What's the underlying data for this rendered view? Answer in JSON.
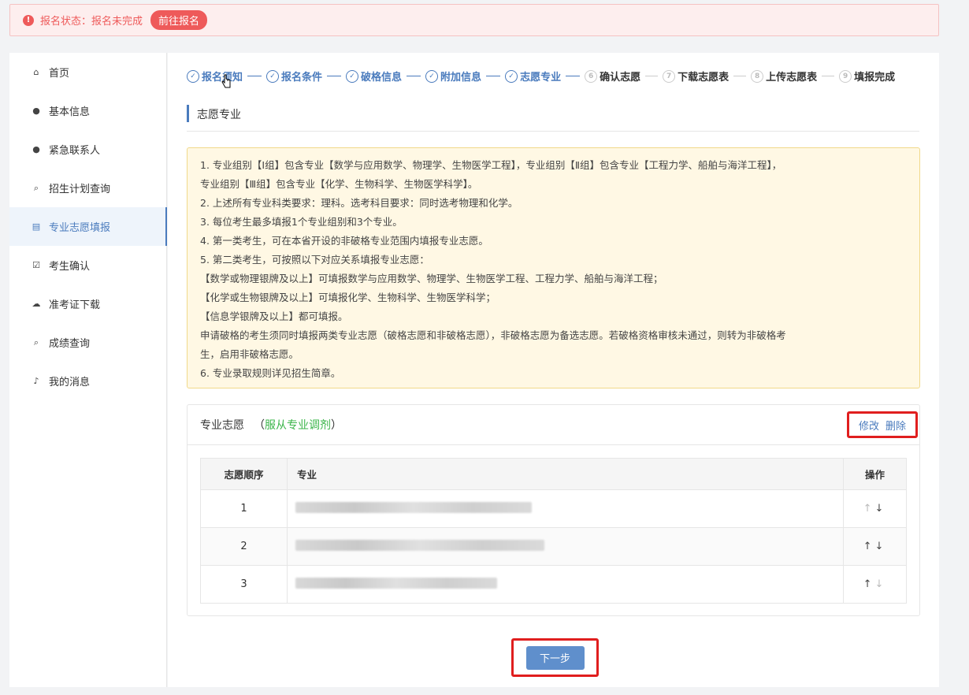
{
  "alert": {
    "status_text": "报名状态：报名未完成",
    "action_label": "前往报名",
    "icon": "info-icon"
  },
  "sidebar": {
    "items": [
      {
        "label": "首页",
        "icon": "home-icon",
        "glyph": "⌂",
        "active": false
      },
      {
        "label": "基本信息",
        "icon": "user-icon",
        "glyph": "●",
        "active": false
      },
      {
        "label": "紧急联系人",
        "icon": "user-icon",
        "glyph": "●",
        "active": false
      },
      {
        "label": "招生计划查询",
        "icon": "search-icon",
        "glyph": "⌕",
        "active": false
      },
      {
        "label": "专业志愿填报",
        "icon": "document-icon",
        "glyph": "▤",
        "active": true
      },
      {
        "label": "考生确认",
        "icon": "checkbox-icon",
        "glyph": "☑",
        "active": false
      },
      {
        "label": "准考证下载",
        "icon": "cloud-download-icon",
        "glyph": "☁",
        "active": false
      },
      {
        "label": "成绩查询",
        "icon": "search-icon",
        "glyph": "⌕",
        "active": false
      },
      {
        "label": "我的消息",
        "icon": "bell-icon",
        "glyph": "♪",
        "active": false
      }
    ]
  },
  "steps": [
    {
      "label": "报名须知",
      "done": true,
      "mark": "✓"
    },
    {
      "label": "报名条件",
      "done": true,
      "mark": "✓"
    },
    {
      "label": "破格信息",
      "done": true,
      "mark": "✓"
    },
    {
      "label": "附加信息",
      "done": true,
      "mark": "✓"
    },
    {
      "label": "志愿专业",
      "done": true,
      "mark": "✓"
    },
    {
      "label": "确认志愿",
      "done": false,
      "mark": "6"
    },
    {
      "label": "下载志愿表",
      "done": false,
      "mark": "7"
    },
    {
      "label": "上传志愿表",
      "done": false,
      "mark": "8"
    },
    {
      "label": "填报完成",
      "done": false,
      "mark": "9"
    }
  ],
  "section_title": "志愿专业",
  "notice_lines": [
    "1. 专业组别【Ⅰ组】包含专业【数学与应用数学、物理学、生物医学工程】，专业组别【Ⅱ组】包含专业【工程力学、船舶与海洋工程】，",
    "专业组别【Ⅲ组】包含专业【化学、生物科学、生物医学科学】。",
    "2. 上述所有专业科类要求：理科。选考科目要求：同时选考物理和化学。",
    "3. 每位考生最多填报1个专业组别和3个专业。",
    "4. 第一类考生，可在本省开设的非破格专业范围内填报专业志愿。",
    "5. 第二类考生，可按照以下对应关系填报专业志愿：",
    "【数学或物理银牌及以上】可填报数学与应用数学、物理学、生物医学工程、工程力学、船舶与海洋工程；",
    "【化学或生物银牌及以上】可填报化学、生物科学、生物医学科学；",
    "【信息学银牌及以上】都可填报。",
    "申请破格的考生须同时填报两类专业志愿（破格志愿和非破格志愿），非破格志愿为备选志愿。若破格资格审核未通过，则转为非破格考",
    "生，启用非破格志愿。",
    "6. 专业录取规则详见招生简章。"
  ],
  "card": {
    "title": "专业志愿",
    "sub_open": "（",
    "sub_green": "服从专业调剂",
    "sub_close": "）",
    "edit_label": "修改",
    "delete_label": "删除"
  },
  "table": {
    "headers": [
      "志愿顺序",
      "专业",
      "操作"
    ],
    "rows": [
      {
        "order": "1",
        "up": "↑",
        "down": "↓",
        "up_dim": true,
        "down_dim": false
      },
      {
        "order": "2",
        "up": "↑",
        "down": "↓",
        "up_dim": false,
        "down_dim": false
      },
      {
        "order": "3",
        "up": "↑",
        "down": "↓",
        "up_dim": false,
        "down_dim": true
      }
    ]
  },
  "next_label": "下一步"
}
